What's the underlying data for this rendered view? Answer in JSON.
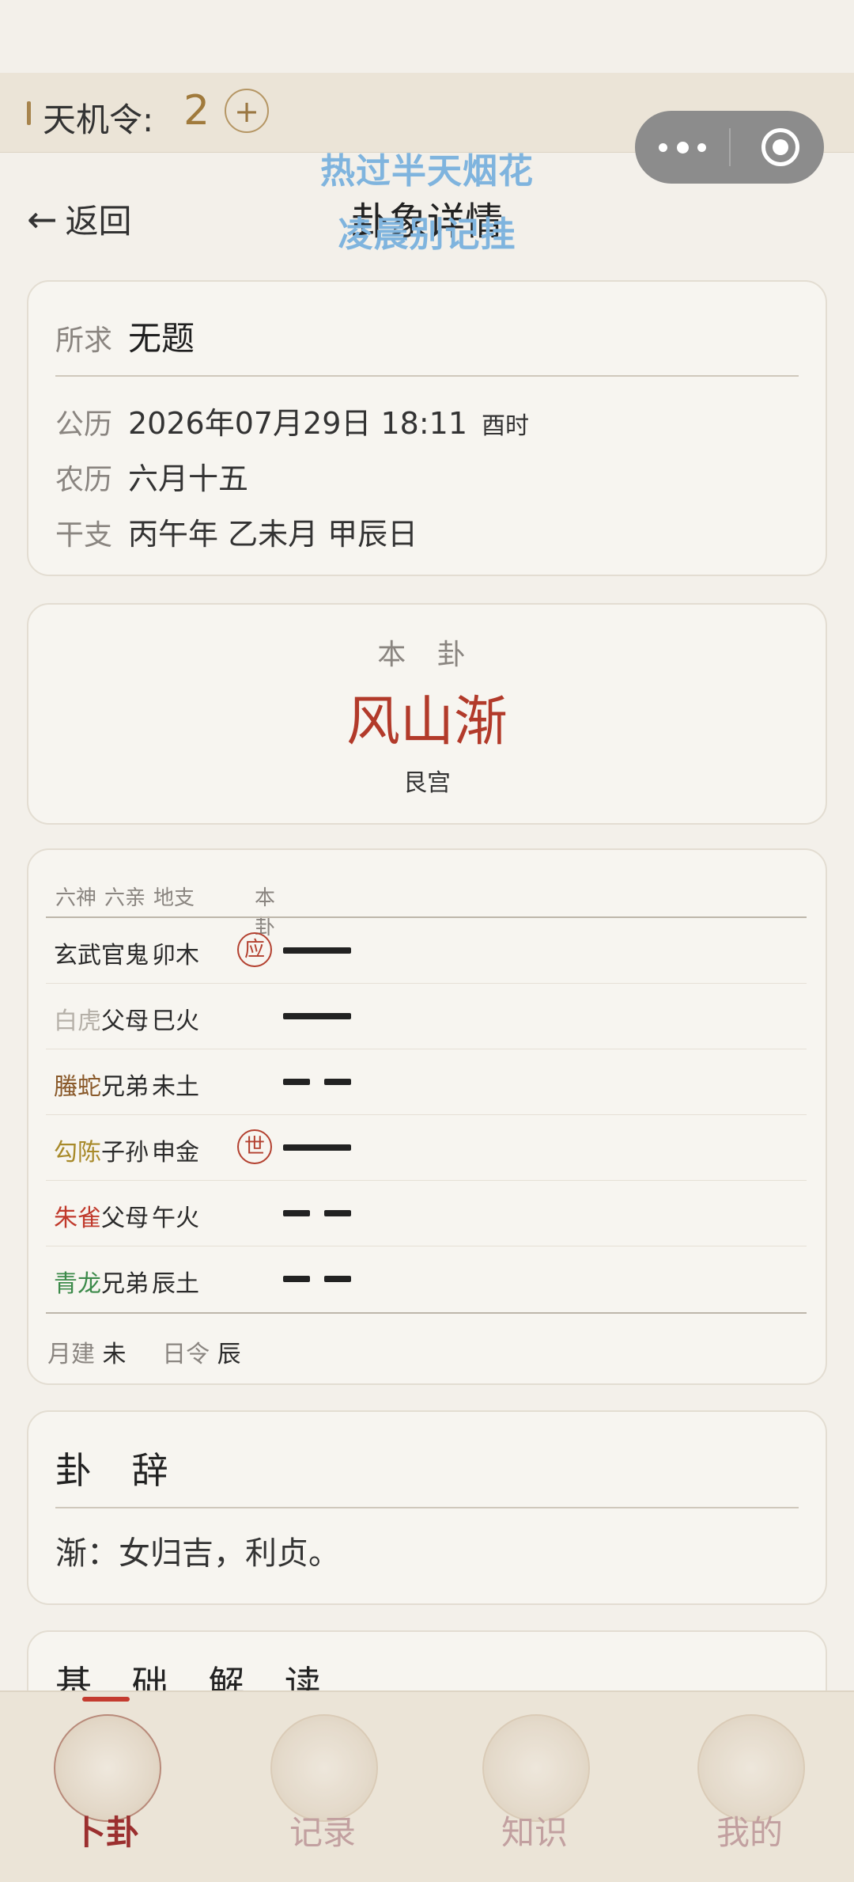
{
  "header": {
    "token_label": "天机令:",
    "token_count": "2",
    "token_add": "+",
    "back_label": "返回",
    "title": "卦象详情",
    "overlay_line1": "热过半天烟花",
    "overlay_line2": "凌晨别记挂"
  },
  "info": {
    "seek_label": "所求",
    "seek_value": "无题",
    "solar_label": "公历",
    "solar_value": "2026年07月29日  18:11",
    "solar_hour": "酉时",
    "lunar_label": "农历",
    "lunar_value": "六月十五",
    "ganzhi_label": "干支",
    "ganzhi_value": "丙午年 乙未月 甲辰日"
  },
  "gua": {
    "label": "本 卦",
    "name": "风山渐",
    "palace": "艮宫"
  },
  "table": {
    "headers": [
      "六神",
      "六亲",
      "地支",
      "本卦"
    ],
    "rows": [
      {
        "shen": "玄武",
        "shen_color": "#2b2b2b",
        "qin": "官鬼",
        "zhi": "卯木",
        "mark": "应",
        "line": "yang"
      },
      {
        "shen": "白虎",
        "shen_color": "#b5b0a8",
        "qin": "父母",
        "zhi": "巳火",
        "mark": "",
        "line": "yang"
      },
      {
        "shen": "螣蛇",
        "shen_color": "#8a5a2b",
        "qin": "兄弟",
        "zhi": "未土",
        "mark": "",
        "line": "yin"
      },
      {
        "shen": "勾陈",
        "shen_color": "#a88a2a",
        "qin": "子孙",
        "zhi": "申金",
        "mark": "世",
        "line": "yang"
      },
      {
        "shen": "朱雀",
        "shen_color": "#c0392b",
        "qin": "父母",
        "zhi": "午火",
        "mark": "",
        "line": "yin"
      },
      {
        "shen": "青龙",
        "shen_color": "#3c8a4a",
        "qin": "兄弟",
        "zhi": "辰土",
        "mark": "",
        "line": "yin"
      }
    ],
    "month_label": "月建",
    "month_value": "未",
    "day_label": "日令",
    "day_value": "辰"
  },
  "guaci": {
    "title": "卦 辞",
    "text": "渐：女归吉，利贞。"
  },
  "basic": {
    "title": "基 础 解 读"
  },
  "tabs": [
    {
      "label": "卜卦",
      "active": true,
      "icon": "bagua-icon"
    },
    {
      "label": "记录",
      "active": false,
      "icon": "scroll-icon"
    },
    {
      "label": "知识",
      "active": false,
      "icon": "book-icon"
    },
    {
      "label": "我的",
      "active": false,
      "icon": "compass-icon"
    }
  ],
  "colors": {
    "accent": "#b23a2a",
    "gold": "#a07a3c",
    "background": "#f3f0ea"
  }
}
